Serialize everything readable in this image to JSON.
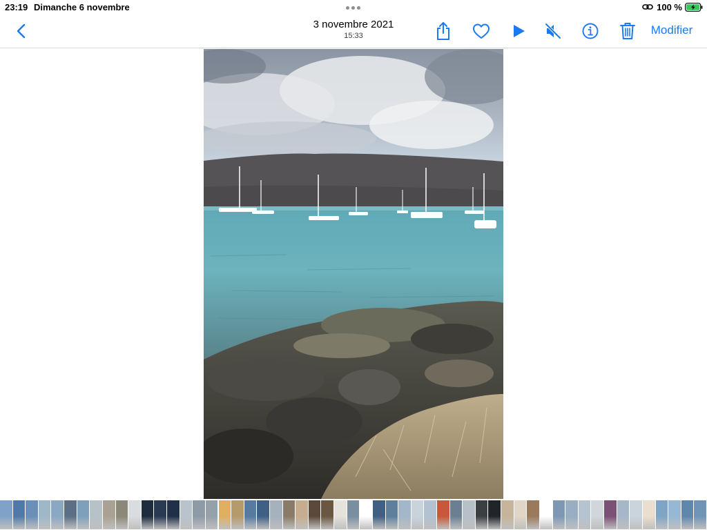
{
  "status_bar": {
    "time": "23:19",
    "date": "Dimanche 6 novembre",
    "battery_percent": "100 %",
    "battery_level": 1.0,
    "charging": true
  },
  "toolbar": {
    "title_date": "3 novembre 2021",
    "title_time": "15:33",
    "edit_label": "Modifier",
    "accent_color": "#1a7af0",
    "icons": [
      "chevron-left-icon",
      "share-icon",
      "heart-icon",
      "play-icon",
      "speaker-muted-icon",
      "info-icon",
      "trash-icon"
    ]
  },
  "thumbnails": {
    "colors": [
      "#7fa3c8",
      "#4f79a8",
      "#6a8fb8",
      "#9fb8c8",
      "#8aa8c4",
      "#5c6f86",
      "#7ea0bd",
      "#b7c2c8",
      "#a9a294",
      "#8b8779",
      "#d9dde0",
      "#1d2c3e",
      "#2a3a52",
      "#1f3048",
      "#b9c3cc",
      "#8f9aa7",
      "#96a0a9",
      "#e0b060",
      "#b59a6b",
      "#567aa0",
      "#3f5f84",
      "#a5b1bd",
      "#8a7a68",
      "#c7ad8f",
      "#5b4a3c",
      "#6b5642",
      "#e5e2dc",
      "#7a8ea1",
      "#ffffff",
      "#415f82",
      "#5f7f9f",
      "#a2b7c9",
      "#c9d3dc",
      "#b2c2d2",
      "#c7583a",
      "#6b7f93",
      "#b7c0c6",
      "#3a3f44",
      "#20252a",
      "#c6b59a",
      "#e1d6c6",
      "#9b7a5c",
      "#ffffff",
      "#7d98b4",
      "#97aec3",
      "#b6c4d1",
      "#d0d6dc",
      "#7b4f76",
      "#a6b7c7",
      "#cad4dd",
      "#eadfce",
      "#7ea5c7",
      "#97b8d4",
      "#5f86ad",
      "#6f94b8"
    ]
  }
}
